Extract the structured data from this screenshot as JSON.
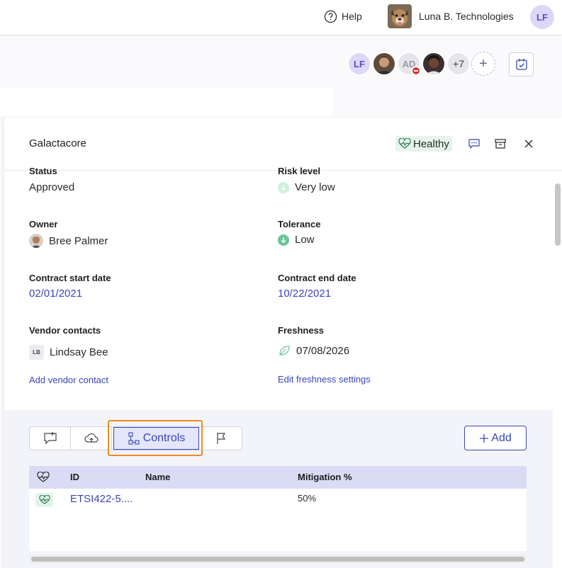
{
  "header": {
    "help_label": "Help",
    "org_name": "Luna B. Technologies",
    "user_initials": "LF"
  },
  "collaborators": {
    "first_initials": "LF",
    "ad_initials": "AD",
    "more_count": "+7",
    "add_symbol": "+"
  },
  "panel": {
    "title": "Galactacore",
    "health_label": "Healthy",
    "icons": [
      "comment-icon",
      "archive-icon",
      "close-icon"
    ]
  },
  "fields": {
    "status_label": "Status",
    "status_value": "Approved",
    "risk_label": "Risk level",
    "risk_value": "Very low",
    "owner_label": "Owner",
    "owner_value": "Bree Palmer",
    "tolerance_label": "Tolerance",
    "tolerance_value": "Low",
    "start_label": "Contract start date",
    "start_value": "02/01/2021",
    "end_label": "Contract end date",
    "end_value": "10/22/2021",
    "contacts_label": "Vendor contacts",
    "contact_initials": "LB",
    "contact_name": "Lindsay Bee",
    "freshness_label": "Freshness",
    "freshness_value": "07/08/2026",
    "add_contact_link": "Add vendor contact",
    "edit_freshness_link": "Edit freshness settings"
  },
  "tabs": {
    "items": [
      "assessment-icon",
      "cloud-icon",
      "Controls",
      "flag-icon"
    ],
    "active_label": "Controls",
    "add_label": "Add"
  },
  "table": {
    "columns": [
      "",
      "ID",
      "Name",
      "Mitigation %"
    ],
    "rows": [
      {
        "id": "ETSI422-5....",
        "name": "",
        "mitigation": "50%"
      }
    ]
  },
  "colors": {
    "accent": "#3a45b8",
    "healthy_bg": "#e6f4ec",
    "focus_ring": "#f08a1e"
  }
}
